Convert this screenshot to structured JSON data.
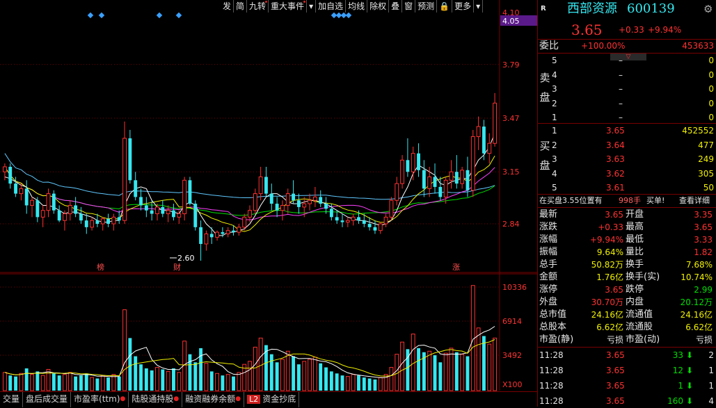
{
  "toolbar": {
    "items": [
      "发",
      "简",
      "九转",
      "重大事件",
      "▾",
      "加自选",
      "均线",
      "除权",
      "叠",
      "窗",
      "预测",
      "🔒",
      "更多",
      "▾"
    ],
    "dots": [
      false,
      false,
      true,
      true,
      false,
      false,
      false,
      false,
      false,
      false,
      false,
      false,
      false,
      false
    ]
  },
  "price_axis": {
    "labels": [
      "4.10",
      "4.05",
      "3.79",
      "3.47",
      "3.15",
      "2.84"
    ],
    "current": "4.05"
  },
  "markers": {
    "low_label": "2.60",
    "bang": "榜",
    "cai": "财",
    "zhang": "涨"
  },
  "volume_axis": {
    "labels": [
      "10336",
      "6914",
      "3492",
      "X100"
    ]
  },
  "bottom_tabs": [
    {
      "label": "交量",
      "dot": false
    },
    {
      "label": "盘后成交量",
      "dot": false
    },
    {
      "label": "市盈率(ttm)",
      "dot": true
    },
    {
      "label": "陆股通持股",
      "dot": true
    },
    {
      "label": "融资融券余额",
      "dot": true
    },
    {
      "label": "资金抄底",
      "dot": false,
      "l2": "L2"
    }
  ],
  "quote": {
    "r_badge": "R",
    "name": "西部资源",
    "code": "600139",
    "price": "3.65",
    "change": "+0.33",
    "change_pct": "+9.94%",
    "weibi_label": "委比",
    "weibi_pct": "+100.00%",
    "weibi_val": "453633",
    "sell_label": "卖盘",
    "buy_label": "买盘",
    "sell": [
      {
        "lvl": "5",
        "price": "–",
        "vol": "0"
      },
      {
        "lvl": "4",
        "price": "–",
        "vol": "0"
      },
      {
        "lvl": "3",
        "price": "–",
        "vol": "0"
      },
      {
        "lvl": "2",
        "price": "–",
        "vol": "0"
      },
      {
        "lvl": "1",
        "price": "–",
        "vol": "0"
      }
    ],
    "buy": [
      {
        "lvl": "1",
        "price": "3.65",
        "vol": "452552"
      },
      {
        "lvl": "2",
        "price": "3.64",
        "vol": "477"
      },
      {
        "lvl": "3",
        "price": "3.63",
        "vol": "249"
      },
      {
        "lvl": "4",
        "price": "3.62",
        "vol": "305"
      },
      {
        "lvl": "5",
        "price": "3.61",
        "vol": "50"
      }
    ],
    "info_text": "在买盘3.55位置有",
    "info_vol": "998手",
    "info_buy": "买单!",
    "info_link": "查看详细",
    "stats": [
      {
        "l1": "最新",
        "v1": "3.65",
        "c1": "red",
        "l2": "开盘",
        "v2": "3.35",
        "c2": "red"
      },
      {
        "l1": "涨跌",
        "v1": "+0.33",
        "c1": "red",
        "l2": "最高",
        "v2": "3.65",
        "c2": "red"
      },
      {
        "l1": "涨幅",
        "v1": "+9.94%",
        "c1": "red",
        "l2": "最低",
        "v2": "3.33",
        "c2": "red"
      },
      {
        "l1": "振幅",
        "v1": "9.64%",
        "c1": "yellow",
        "l2": "量比",
        "v2": "1.82",
        "c2": "red"
      },
      {
        "l1": "总手",
        "v1": "50.82万",
        "c1": "yellow",
        "l2": "换手",
        "v2": "7.68%",
        "c2": "yellow"
      },
      {
        "l1": "金额",
        "v1": "1.76亿",
        "c1": "yellow",
        "l2": "换手(实)",
        "v2": "10.74%",
        "c2": "yellow"
      },
      {
        "l1": "涨停",
        "v1": "3.65",
        "c1": "red",
        "l2": "跌停",
        "v2": "2.99",
        "c2": "green"
      },
      {
        "l1": "外盘",
        "v1": "30.70万",
        "c1": "red",
        "l2": "内盘",
        "v2": "20.12万",
        "c2": "green"
      },
      {
        "l1": "总市值",
        "v1": "24.16亿",
        "c1": "yellow",
        "l2": "流通值",
        "v2": "24.16亿",
        "c2": "yellow"
      },
      {
        "l1": "总股本",
        "v1": "6.62亿",
        "c1": "yellow",
        "l2": "流通股",
        "v2": "6.62亿",
        "c2": "yellow"
      },
      {
        "l1": "市盈(静)",
        "v1": "亏损",
        "c1": "white",
        "l2": "市盈(动)",
        "v2": "亏损",
        "c2": "white"
      }
    ],
    "ticks": [
      {
        "time": "11:28",
        "price": "3.65",
        "vol": "33",
        "n": "2"
      },
      {
        "time": "11:28",
        "price": "3.65",
        "vol": "12",
        "n": "1"
      },
      {
        "time": "11:28",
        "price": "3.65",
        "vol": "1",
        "n": "1"
      },
      {
        "time": "11:28",
        "price": "3.65",
        "vol": "160",
        "n": "4"
      }
    ]
  },
  "colors": {
    "up": "#ff3232",
    "down": "#35e8f0",
    "ma5": "#ffffff",
    "ma10": "#f0f000",
    "ma20": "#ff40ff",
    "ma30": "#00e000",
    "ma60": "#60c8ff",
    "grid": "#7a0000"
  },
  "chart_data": {
    "type": "candlestick",
    "price_range": [
      2.55,
      4.1
    ],
    "volume_range": [
      0,
      11000
    ],
    "candles": [
      [
        3.15,
        3.2,
        3.1,
        3.18
      ],
      [
        3.18,
        3.2,
        3.05,
        3.08
      ],
      [
        3.08,
        3.12,
        3.0,
        3.02
      ],
      [
        3.02,
        3.08,
        2.98,
        3.05
      ],
      [
        3.05,
        3.1,
        2.9,
        2.95
      ],
      [
        2.95,
        3.0,
        2.88,
        2.98
      ],
      [
        2.98,
        3.0,
        2.85,
        2.88
      ],
      [
        2.88,
        2.95,
        2.82,
        2.92
      ],
      [
        2.92,
        3.05,
        2.88,
        3.02
      ],
      [
        3.02,
        3.04,
        2.9,
        2.92
      ],
      [
        2.92,
        2.95,
        2.85,
        2.86
      ],
      [
        2.86,
        2.92,
        2.8,
        2.9
      ],
      [
        2.9,
        2.98,
        2.86,
        2.95
      ],
      [
        2.95,
        3.0,
        2.88,
        2.9
      ],
      [
        2.9,
        2.94,
        2.84,
        2.86
      ],
      [
        2.86,
        2.9,
        2.78,
        2.82
      ],
      [
        2.82,
        2.88,
        2.8,
        2.86
      ],
      [
        2.86,
        2.9,
        2.82,
        2.84
      ],
      [
        2.84,
        2.88,
        2.8,
        2.87
      ],
      [
        2.87,
        2.9,
        2.82,
        2.84
      ],
      [
        2.84,
        2.9,
        2.8,
        2.88
      ],
      [
        2.88,
        2.92,
        2.84,
        2.86
      ],
      [
        2.86,
        3.45,
        2.84,
        3.35
      ],
      [
        3.35,
        3.4,
        3.08,
        3.1
      ],
      [
        3.1,
        3.15,
        2.98,
        3.0
      ],
      [
        3.0,
        3.05,
        2.92,
        2.95
      ],
      [
        2.95,
        3.0,
        2.88,
        2.92
      ],
      [
        2.92,
        2.98,
        2.86,
        2.9
      ],
      [
        2.9,
        2.96,
        2.86,
        2.94
      ],
      [
        2.94,
        2.98,
        2.88,
        2.9
      ],
      [
        2.9,
        2.95,
        2.85,
        2.92
      ],
      [
        2.92,
        2.96,
        2.86,
        2.88
      ],
      [
        2.88,
        2.92,
        2.84,
        2.9
      ],
      [
        2.9,
        3.12,
        2.86,
        3.1
      ],
      [
        3.1,
        3.12,
        2.95,
        2.96
      ],
      [
        2.96,
        2.98,
        2.8,
        2.82
      ],
      [
        2.82,
        2.86,
        2.62,
        2.72
      ],
      [
        2.72,
        2.8,
        2.68,
        2.78
      ],
      [
        2.78,
        2.82,
        2.72,
        2.76
      ],
      [
        2.76,
        2.8,
        2.74,
        2.79
      ],
      [
        2.79,
        2.82,
        2.76,
        2.78
      ],
      [
        2.78,
        2.82,
        2.76,
        2.8
      ],
      [
        2.8,
        2.83,
        2.77,
        2.79
      ],
      [
        2.79,
        2.84,
        2.77,
        2.82
      ],
      [
        2.82,
        2.9,
        2.8,
        2.88
      ],
      [
        2.88,
        2.95,
        2.85,
        2.92
      ],
      [
        2.92,
        3.05,
        2.9,
        3.02
      ],
      [
        3.02,
        3.18,
        2.98,
        3.12
      ],
      [
        3.12,
        3.18,
        3.0,
        3.02
      ],
      [
        3.02,
        3.08,
        2.92,
        2.96
      ],
      [
        2.96,
        3.0,
        2.88,
        2.92
      ],
      [
        2.92,
        2.98,
        2.86,
        2.95
      ],
      [
        2.95,
        3.05,
        2.9,
        3.02
      ],
      [
        3.02,
        3.1,
        2.96,
        2.98
      ],
      [
        2.98,
        3.02,
        2.9,
        2.94
      ],
      [
        2.94,
        3.0,
        2.88,
        2.96
      ],
      [
        2.96,
        3.02,
        2.92,
        2.98
      ],
      [
        2.98,
        3.06,
        2.94,
        3.0
      ],
      [
        3.0,
        3.04,
        2.94,
        2.96
      ],
      [
        2.96,
        3.0,
        2.9,
        2.93
      ],
      [
        2.93,
        2.96,
        2.86,
        2.88
      ],
      [
        2.88,
        2.92,
        2.84,
        2.86
      ],
      [
        2.86,
        2.9,
        2.82,
        2.85
      ],
      [
        2.85,
        2.88,
        2.82,
        2.86
      ],
      [
        2.86,
        2.9,
        2.83,
        2.88
      ],
      [
        2.88,
        2.92,
        2.84,
        2.86
      ],
      [
        2.86,
        2.9,
        2.82,
        2.84
      ],
      [
        2.84,
        2.88,
        2.8,
        2.82
      ],
      [
        2.82,
        2.86,
        2.78,
        2.8
      ],
      [
        2.8,
        2.85,
        2.78,
        2.84
      ],
      [
        2.84,
        2.9,
        2.82,
        2.88
      ],
      [
        2.88,
        3.0,
        2.86,
        2.98
      ],
      [
        2.98,
        3.12,
        2.95,
        3.08
      ],
      [
        3.08,
        3.25,
        3.05,
        3.22
      ],
      [
        3.22,
        3.35,
        3.12,
        3.15
      ],
      [
        3.15,
        3.3,
        3.1,
        3.26
      ],
      [
        3.26,
        3.32,
        3.12,
        3.16
      ],
      [
        3.16,
        3.22,
        3.0,
        3.05
      ],
      [
        3.05,
        3.18,
        3.0,
        3.12
      ],
      [
        3.12,
        3.2,
        3.02,
        3.06
      ],
      [
        3.06,
        3.12,
        2.98,
        3.0
      ],
      [
        3.0,
        3.12,
        2.96,
        3.1
      ],
      [
        3.1,
        3.22,
        3.05,
        3.15
      ],
      [
        3.15,
        3.25,
        3.05,
        3.08
      ],
      [
        3.08,
        3.18,
        3.05,
        3.16
      ],
      [
        3.16,
        3.24,
        3.0,
        3.04
      ],
      [
        3.04,
        3.4,
        3.0,
        3.36
      ],
      [
        3.36,
        3.48,
        3.28,
        3.42
      ],
      [
        3.42,
        3.46,
        3.22,
        3.26
      ],
      [
        3.26,
        3.38,
        3.2,
        3.32
      ],
      [
        3.32,
        3.62,
        3.3,
        3.56
      ]
    ],
    "volumes": [
      1800,
      1500,
      1400,
      1700,
      2200,
      1600,
      1900,
      1500,
      2100,
      1700,
      1500,
      1600,
      1800,
      1400,
      1500,
      1700,
      1300,
      1200,
      1500,
      1300,
      1600,
      1400,
      8000,
      5200,
      3400,
      2600,
      2200,
      2000,
      2300,
      2100,
      1900,
      2200,
      1800,
      4900,
      3600,
      2800,
      4200,
      2700,
      1900,
      1700,
      1500,
      1600,
      1400,
      1800,
      2600,
      2900,
      4300,
      5200,
      4500,
      3600,
      2800,
      3100,
      3900,
      3400,
      2600,
      2900,
      3100,
      3300,
      2700,
      2300,
      1900,
      1700,
      1500,
      1400,
      1600,
      1500,
      1300,
      1200,
      1100,
      1300,
      1600,
      2300,
      3600,
      4800,
      4100,
      5600,
      4200,
      3800,
      3900,
      3500,
      2800,
      3700,
      4200,
      3800,
      3600,
      3400,
      10400,
      6200,
      5400,
      4600,
      5200
    ],
    "ma5": [
      3.12,
      3.11,
      3.09,
      3.07,
      3.06,
      3.0,
      2.98,
      2.95,
      2.95,
      2.94,
      2.92,
      2.9,
      2.91,
      2.91,
      2.9,
      2.89,
      2.88,
      2.86,
      2.85,
      2.85,
      2.86,
      2.86,
      2.95,
      3.02,
      3.05,
      3.06,
      3.05,
      2.98,
      2.94,
      2.92,
      2.92,
      2.91,
      2.9,
      2.95,
      2.97,
      2.95,
      2.89,
      2.84,
      2.81,
      2.77,
      2.77,
      2.79,
      2.79,
      2.8,
      2.81,
      2.84,
      2.89,
      2.95,
      3.0,
      3.02,
      3.02,
      3.0,
      2.97,
      2.96,
      2.96,
      2.97,
      2.98,
      2.98,
      2.97,
      2.96,
      2.94,
      2.92,
      2.9,
      2.88,
      2.87,
      2.86,
      2.86,
      2.85,
      2.84,
      2.83,
      2.84,
      2.86,
      2.92,
      3.0,
      3.06,
      3.14,
      3.19,
      3.17,
      3.15,
      3.13,
      3.08,
      3.07,
      3.09,
      3.1,
      3.11,
      3.11,
      3.16,
      3.22,
      3.25,
      3.3,
      3.38
    ]
  }
}
